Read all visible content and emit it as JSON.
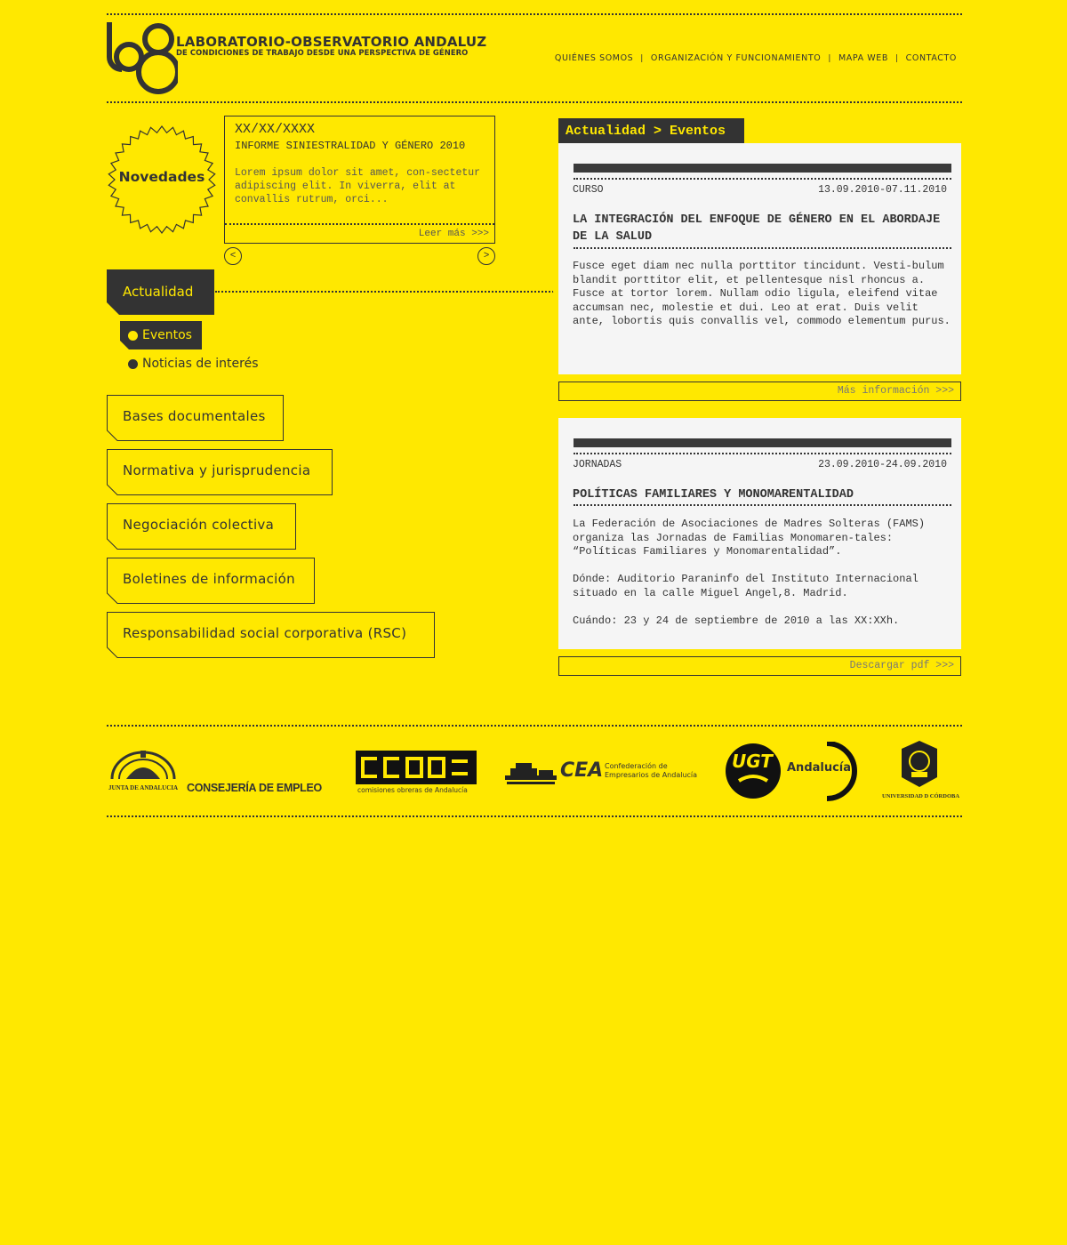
{
  "header": {
    "title": "LABORATORIO-OBSERVATORIO ANDALUZ",
    "subtitle": "DE CONDICIONES DE TRABAJO DESDE UNA PERSPECTIVA DE GÉNERO",
    "nav": [
      "QUIÉNES SOMOS",
      "ORGANIZACIÓN Y FUNCIONAMIENTO",
      "MAPA WEB",
      "CONTACTO"
    ],
    "nav_separator": "|"
  },
  "novedades": {
    "badge": "Novedades",
    "date": "XX/XX/XXXX",
    "title": "INFORME SINIESTRALIDAD Y GÉNERO 2010",
    "text": "Lorem ipsum dolor sit amet, con-sectetur adipiscing elit. In viverra, elit at convallis rutrum, orci...",
    "more": "Leer más >>>",
    "prev": "<",
    "next": ">"
  },
  "sidebar": {
    "active": "Actualidad",
    "subitems": [
      "Eventos",
      "Noticias de interés"
    ],
    "items": [
      "Bases documentales",
      "Normativa y jurisprudencia",
      "Negociación colectiva",
      "Boletines de información",
      "Responsabilidad social corporativa (RSC)"
    ]
  },
  "main": {
    "breadcrumb": "Actualidad > Eventos",
    "events": [
      {
        "type": "CURSO",
        "date": "13.09.2010-07.11.2010",
        "title": "LA INTEGRACIÓN DEL ENFOQUE DE GÉNERO EN EL ABORDAJE DE LA SALUD",
        "paragraphs": [
          "Fusce eget diam nec nulla porttitor tincidunt. Vesti-bulum blandit porttitor elit, et pellentesque nisl rhoncus a. Fusce at tortor lorem. Nullam odio ligula, eleifend vitae accumsan nec, molestie et dui. Leo at erat. Duis velit ante, lobortis quis convallis vel, commodo elementum purus."
        ],
        "more": "Más información >>>"
      },
      {
        "type": "JORNADAS",
        "date": "23.09.2010-24.09.2010",
        "title": "POLÍTICAS FAMILIARES Y MONOMARENTALIDAD",
        "paragraphs": [
          "La Federación de Asociaciones de Madres Solteras (FAMS) organiza las Jornadas de Familias Monomaren-tales: “Políticas Familiares y Monomarentalidad”.",
          "Dónde: Auditorio Paraninfo del Instituto Internacional situado en la calle Miguel Angel,8. Madrid.",
          "Cuándo: 23 y 24 de septiembre de 2010 a las XX:XXh."
        ],
        "more": "Descargar pdf >>>"
      }
    ]
  },
  "footer": {
    "logos": [
      {
        "text": "JUNTA DE ANDALUCIA",
        "icon": "junta-andalucia-logo"
      },
      {
        "text": "CONSEJERÍA DE EMPLEO",
        "icon": "consejeria-logo"
      },
      {
        "text": "comisiones obreras de Andalucía",
        "icon": "ccoo-logo"
      },
      {
        "text": "CEA",
        "icon": "cea-logo"
      },
      {
        "text": "Confederación de Empresarios de Andalucía",
        "icon": "cea-logo"
      },
      {
        "text": "UGT",
        "icon": "ugt-logo"
      },
      {
        "text": "Andalucía",
        "icon": "ugt-logo"
      },
      {
        "text": "UNIVERSIDAD D CÓRDOBA",
        "icon": "uco-logo"
      }
    ]
  },
  "colors": {
    "background": "#ffe800",
    "dark": "#333333",
    "card": "#f5f5f5"
  }
}
